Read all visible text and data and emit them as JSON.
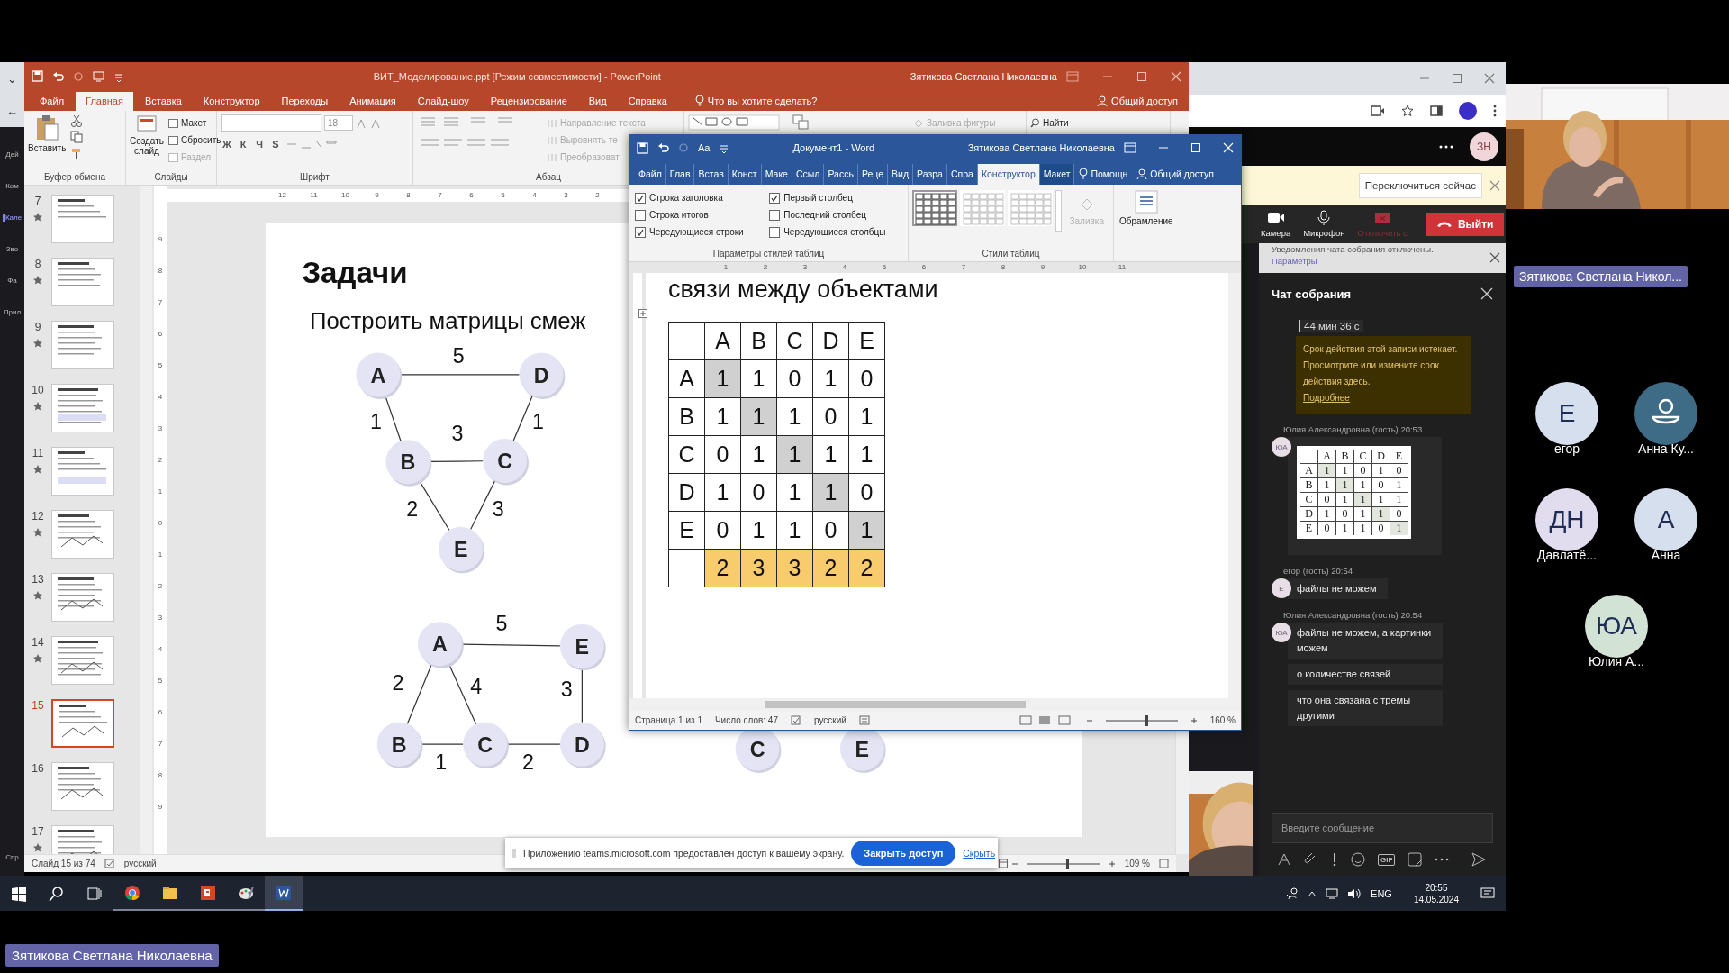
{
  "left_rail": {
    "glyphs": [
      "⌄",
      "←"
    ],
    "items": [
      {
        "label": "Дей",
        "selected": false
      },
      {
        "label": "Ком",
        "selected": false
      },
      {
        "label": "Кале",
        "selected": true
      },
      {
        "label": "Зво",
        "selected": false
      },
      {
        "label": "Фа",
        "selected": false
      },
      {
        "label": "Прил",
        "selected": false
      },
      {
        "label": "Спр",
        "selected": false
      }
    ]
  },
  "powerpoint": {
    "title": "ВИТ_Моделирование.ppt [Режим совместимости]  -  PowerPoint",
    "user": "Зятикова Светлана Николаевна",
    "tabs": [
      {
        "label": "Файл",
        "selected": false
      },
      {
        "label": "Главная",
        "selected": true
      },
      {
        "label": "Вставка",
        "selected": false
      },
      {
        "label": "Конструктор",
        "selected": false
      },
      {
        "label": "Переходы",
        "selected": false
      },
      {
        "label": "Анимация",
        "selected": false
      },
      {
        "label": "Слайд-шоу",
        "selected": false
      },
      {
        "label": "Рецензирование",
        "selected": false
      },
      {
        "label": "Вид",
        "selected": false
      },
      {
        "label": "Справка",
        "selected": false
      }
    ],
    "tell_me": "Что вы хотите сделать?",
    "share": "Общий доступ",
    "ribbon": {
      "paste": "Вставить",
      "new_slide": "Создать слайд",
      "slide_buttons": [
        {
          "label": "Макет",
          "disabled": false
        },
        {
          "label": "Сбросить",
          "disabled": false
        },
        {
          "label": "Раздел",
          "disabled": true
        }
      ],
      "font_size": "18",
      "format_buttons": [
        "Ж",
        "К",
        "Ч",
        "S"
      ],
      "paragraph_buttons": [
        {
          "label": "Направление текста",
          "disabled": true
        },
        {
          "label": "Выровнять те",
          "disabled": true
        },
        {
          "label": "Преобразоват",
          "disabled": true
        }
      ],
      "shape_fill": {
        "label": "Заливка фигуры",
        "disabled": true
      },
      "find": "Найти",
      "groups": [
        "Буфер обмена",
        "Слайды",
        "Шрифт",
        "Абзац"
      ]
    },
    "thumbnails": [
      {
        "number": "7",
        "starred": true,
        "selected": false
      },
      {
        "number": "8",
        "starred": true,
        "selected": false
      },
      {
        "number": "9",
        "starred": true,
        "selected": false
      },
      {
        "number": "10",
        "starred": true,
        "selected": false
      },
      {
        "number": "11",
        "starred": true,
        "selected": false
      },
      {
        "number": "12",
        "starred": true,
        "selected": false
      },
      {
        "number": "13",
        "starred": true,
        "selected": false
      },
      {
        "number": "14",
        "starred": true,
        "selected": false
      },
      {
        "number": "15",
        "starred": false,
        "selected": true
      },
      {
        "number": "16",
        "starred": false,
        "selected": false
      },
      {
        "number": "17",
        "starred": true,
        "selected": false
      }
    ],
    "hruler": [
      "12",
      "11",
      "10",
      "9",
      "8",
      "7",
      "6",
      "5",
      "4",
      "3",
      "2"
    ],
    "vruler": [
      "9",
      "8",
      "7",
      "6",
      "5",
      "4",
      "3",
      "2",
      "1",
      "0",
      "1",
      "2",
      "3",
      "4",
      "5",
      "6",
      "7",
      "8",
      "9"
    ],
    "slide": {
      "title": "Задачи",
      "text": "Построить матрицы смеж",
      "graphs": [
        {
          "nodes": [
            "A",
            "D",
            "B",
            "C",
            "E"
          ],
          "edges": [
            {
              "label": "5"
            },
            {
              "label": "1"
            },
            {
              "label": "3"
            },
            {
              "label": "1"
            },
            {
              "label": "2"
            },
            {
              "label": "3"
            }
          ]
        },
        {
          "nodes": [
            "A",
            "E",
            "B",
            "C",
            "D"
          ],
          "edges": [
            {
              "label": "5"
            },
            {
              "label": "2"
            },
            {
              "label": "4"
            },
            {
              "label": "3"
            },
            {
              "label": "1"
            },
            {
              "label": "2"
            }
          ]
        },
        {
          "nodes": [
            "C",
            "E"
          ]
        }
      ]
    },
    "status": {
      "slide": "Слайд 15 из 74",
      "language": "русский",
      "zoom": "109 %",
      "zoom_slider": {
        "level": 0.54
      }
    }
  },
  "word": {
    "qat_font": "Aa",
    "title": "Документ1  -  Word",
    "user": "Зятикова Светлана Николаевна",
    "tabs": [
      {
        "label": "Файл",
        "selected": false,
        "contextual": false
      },
      {
        "label": "Глав",
        "selected": false,
        "contextual": false
      },
      {
        "label": "Встав",
        "selected": false,
        "contextual": false
      },
      {
        "label": "Конст",
        "selected": false,
        "contextual": false
      },
      {
        "label": "Маке",
        "selected": false,
        "contextual": false
      },
      {
        "label": "Ссыл",
        "selected": false,
        "contextual": false
      },
      {
        "label": "Рассь",
        "selected": false,
        "contextual": false
      },
      {
        "label": "Реце",
        "selected": false,
        "contextual": false
      },
      {
        "label": "Вид",
        "selected": false,
        "contextual": false
      },
      {
        "label": "Разра",
        "selected": false,
        "contextual": false
      },
      {
        "label": "Спра",
        "selected": false,
        "contextual": false
      },
      {
        "label": "Конструктор",
        "selected": true,
        "contextual": true
      },
      {
        "label": "Макет",
        "selected": false,
        "contextual": true
      }
    ],
    "help": "Помощн",
    "share": "Общий доступ",
    "options": [
      {
        "label": "Строка заголовка",
        "checked": true
      },
      {
        "label": "Строка итогов",
        "checked": false
      },
      {
        "label": "Чередующиеся строки",
        "checked": true
      },
      {
        "label": "Первый столбец",
        "checked": true
      },
      {
        "label": "Последний столбец",
        "checked": false
      },
      {
        "label": "Чередующиеся столбцы",
        "checked": false
      }
    ],
    "table_styles": [
      {
        "selected": true
      },
      {
        "selected": false
      },
      {
        "selected": false
      }
    ],
    "shading": {
      "label": "Заливка",
      "disabled": true
    },
    "borders": "Обрамление",
    "groups": [
      "Параметры стилей таблиц",
      "Стили таблиц"
    ],
    "ruler": [
      "1",
      "2",
      "3",
      "4",
      "5",
      "6",
      "7",
      "8",
      "9",
      "10",
      "11"
    ],
    "heading": "связи между объектами",
    "table": {
      "columns": [
        "A",
        "B",
        "C",
        "D",
        "E"
      ],
      "rows": [
        {
          "kind": "data",
          "label": "A",
          "cells": [
            {
              "value": "1",
              "highlighted": true
            },
            {
              "value": "1",
              "highlighted": false
            },
            {
              "value": "0",
              "highlighted": false
            },
            {
              "value": "1",
              "highlighted": false
            },
            {
              "value": "0",
              "highlighted": false
            }
          ]
        },
        {
          "kind": "data",
          "label": "B",
          "cells": [
            {
              "value": "1",
              "highlighted": false
            },
            {
              "value": "1",
              "highlighted": true
            },
            {
              "value": "1",
              "highlighted": false
            },
            {
              "value": "0",
              "highlighted": false
            },
            {
              "value": "1",
              "highlighted": false
            }
          ]
        },
        {
          "kind": "data",
          "label": "C",
          "cells": [
            {
              "value": "0",
              "highlighted": false
            },
            {
              "value": "1",
              "highlighted": false
            },
            {
              "value": "1",
              "highlighted": true
            },
            {
              "value": "1",
              "highlighted": false
            },
            {
              "value": "1",
              "highlighted": false
            }
          ]
        },
        {
          "kind": "data",
          "label": "D",
          "cells": [
            {
              "value": "1",
              "highlighted": false
            },
            {
              "value": "0",
              "highlighted": false
            },
            {
              "value": "1",
              "highlighted": false
            },
            {
              "value": "1",
              "highlighted": true
            },
            {
              "value": "0",
              "highlighted": false
            }
          ]
        },
        {
          "kind": "data",
          "label": "E",
          "cells": [
            {
              "value": "0",
              "highlighted": false
            },
            {
              "value": "1",
              "highlighted": false
            },
            {
              "value": "1",
              "highlighted": false
            },
            {
              "value": "0",
              "highlighted": false
            },
            {
              "value": "1",
              "highlighted": true
            }
          ]
        },
        {
          "kind": "total",
          "cells": [
            {
              "value": "2",
              "highlighted": true
            },
            {
              "value": "3",
              "highlighted": true
            },
            {
              "value": "3",
              "highlighted": true
            },
            {
              "value": "2",
              "highlighted": true
            },
            {
              "value": "2",
              "highlighted": true
            }
          ]
        }
      ]
    },
    "status": {
      "page": "Страница 1 из 1",
      "words": "Число слов: 47",
      "language": "русский",
      "zoom": "160 %",
      "zoom_slider": {
        "level": 0.56
      }
    }
  },
  "teams": {
    "avatar": "ЗН",
    "switch_button": "Переключиться сейчас",
    "controls": [
      {
        "label": "Камера",
        "kind": "camera",
        "disabled": false
      },
      {
        "label": "Микрофон",
        "kind": "mic",
        "disabled": false
      },
      {
        "label": "Отключить с",
        "kind": "share",
        "disabled": true
      }
    ],
    "leave": "Выйти",
    "notice": {
      "text": "Уведомления чата собрания отключены.",
      "link": "Параметры"
    },
    "chat": {
      "title": "Чат собрания",
      "timer": "44 мин 36 с",
      "expiry": {
        "text": "Срок действия этой записи истекает. Просмотрите или измените срок действия ",
        "link": "здесь",
        "tail": ".",
        "more": "Подробнее"
      },
      "messages": [
        {
          "author": "Юлия Александровна (гость)",
          "time": "20:53",
          "avatar": "ЮА",
          "bubbles": [
            {
              "kind": "table",
              "columns": [
                "A",
                "B",
                "C",
                "D",
                "E"
              ],
              "rows": [
                {
                  "label": "A",
                  "cells": [
                    {
                      "value": "1",
                      "highlighted": true
                    },
                    {
                      "value": "1",
                      "highlighted": false
                    },
                    {
                      "value": "0",
                      "highlighted": false
                    },
                    {
                      "value": "1",
                      "highlighted": false
                    },
                    {
                      "value": "0",
                      "highlighted": false
                    }
                  ]
                },
                {
                  "label": "B",
                  "cells": [
                    {
                      "value": "1",
                      "highlighted": false
                    },
                    {
                      "value": "1",
                      "highlighted": true
                    },
                    {
                      "value": "1",
                      "highlighted": false
                    },
                    {
                      "value": "0",
                      "highlighted": false
                    },
                    {
                      "value": "1",
                      "highlighted": false
                    }
                  ]
                },
                {
                  "label": "C",
                  "cells": [
                    {
                      "value": "0",
                      "highlighted": false
                    },
                    {
                      "value": "1",
                      "highlighted": false
                    },
                    {
                      "value": "1",
                      "highlighted": true
                    },
                    {
                      "value": "1",
                      "highlighted": false
                    },
                    {
                      "value": "1",
                      "highlighted": false
                    }
                  ]
                },
                {
                  "label": "D",
                  "cells": [
                    {
                      "value": "1",
                      "highlighted": false
                    },
                    {
                      "value": "0",
                      "highlighted": false
                    },
                    {
                      "value": "1",
                      "highlighted": false
                    },
                    {
                      "value": "1",
                      "highlighted": true
                    },
                    {
                      "value": "0",
                      "highlighted": false
                    }
                  ]
                },
                {
                  "label": "E",
                  "cells": [
                    {
                      "value": "0",
                      "highlighted": false
                    },
                    {
                      "value": "1",
                      "highlighted": false
                    },
                    {
                      "value": "1",
                      "highlighted": false
                    },
                    {
                      "value": "0",
                      "highlighted": false
                    },
                    {
                      "value": "1",
                      "highlighted": true
                    }
                  ]
                }
              ]
            }
          ]
        },
        {
          "author": "егор (гость)",
          "time": "20:54",
          "avatar": "Е",
          "bubbles": [
            {
              "kind": "text",
              "text": "файлы не можем"
            }
          ]
        },
        {
          "author": "Юлия Александровна (гость)",
          "time": "20:54",
          "avatar": "ЮА",
          "bubbles": [
            {
              "kind": "text",
              "text": "файлы не можем, а картинки можем"
            },
            {
              "kind": "text",
              "text": "о количестве связей"
            },
            {
              "kind": "text",
              "text": "что она связана с тремы другими"
            }
          ]
        }
      ],
      "placeholder": "Введите сообщение",
      "gif": "GIF"
    },
    "presenter": "Зятикова Светлана Никол...",
    "participants": [
      {
        "kind": "initials",
        "initials": "Е",
        "name": "егор",
        "color": "#d5dfee"
      },
      {
        "kind": "silhouette",
        "name": "Анна Ку...",
        "color": "#3e6b86"
      },
      {
        "kind": "initials",
        "initials": "ДН",
        "name": "Давлатё...",
        "color": "#e2dcef"
      },
      {
        "kind": "initials",
        "initials": "А",
        "name": "Анна",
        "color": "#d5dfee"
      },
      {
        "kind": "initials",
        "initials": "ЮА",
        "name": "Юлия А...",
        "color": "#d2e3d6"
      }
    ],
    "share_bar": {
      "text": "Приложению teams.microsoft.com предоставлен доступ к вашему экрану.",
      "stop": "Закрыть доступ",
      "hide": "Скрыть"
    }
  },
  "taskbar": {
    "apps": [
      {
        "kind": "chrome",
        "active": false
      },
      {
        "kind": "explorer",
        "active": false
      },
      {
        "kind": "powerpoint",
        "active": false
      },
      {
        "kind": "paint",
        "active": false
      },
      {
        "kind": "word",
        "active": true
      }
    ],
    "language": "ENG",
    "time": "20:55",
    "date": "14.05.2024"
  },
  "name_tag": "Зятикова Светлана Николаевна"
}
